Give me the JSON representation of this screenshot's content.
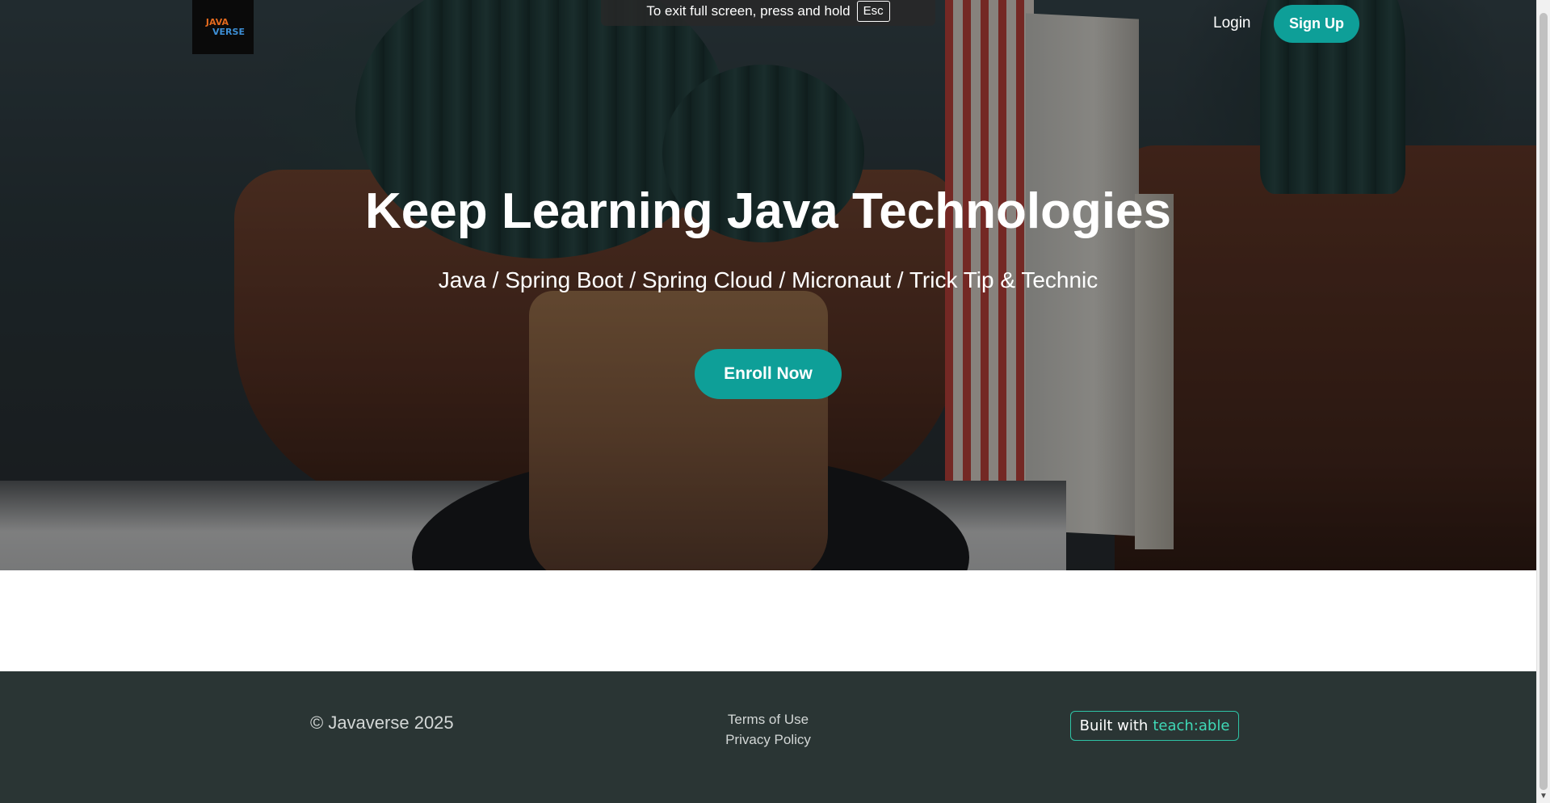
{
  "header": {
    "logo_line1": "JAVA",
    "logo_line2": "VERSE",
    "login_label": "Login",
    "signup_label": "Sign Up"
  },
  "fullscreen_notice": {
    "text": "To exit full screen, press and hold",
    "key": "Esc"
  },
  "hero": {
    "title": "Keep Learning Java Technologies",
    "subtitle": "Java / Spring Boot / Spring Cloud / Micronaut / Trick Tip & Technic",
    "cta_label": "Enroll Now"
  },
  "footer": {
    "copyright": "© Javaverse 2025",
    "links": [
      "Terms of Use",
      "Privacy Policy"
    ],
    "badge_text": "Built with",
    "badge_brand": "teach:able"
  },
  "colors": {
    "accent": "#0e9f98",
    "footer_bg": "#2a3534",
    "badge_brand": "#3fd9b7"
  }
}
